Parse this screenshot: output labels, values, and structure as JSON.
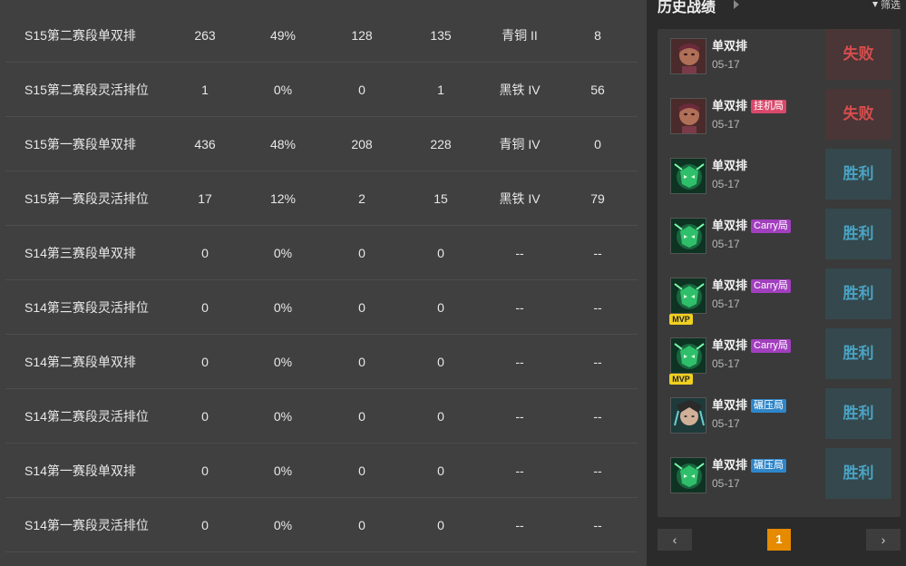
{
  "seasons": [
    {
      "name": "S15第二赛段单双排",
      "games": "263",
      "winrate": "49%",
      "wins": "128",
      "losses": "135",
      "tier": "青铜 II",
      "lp": "8"
    },
    {
      "name": "S15第二赛段灵活排位",
      "games": "1",
      "winrate": "0%",
      "wins": "0",
      "losses": "1",
      "tier": "黑铁 IV",
      "lp": "56"
    },
    {
      "name": "S15第一赛段单双排",
      "games": "436",
      "winrate": "48%",
      "wins": "208",
      "losses": "228",
      "tier": "青铜 IV",
      "lp": "0"
    },
    {
      "name": "S15第一赛段灵活排位",
      "games": "17",
      "winrate": "12%",
      "wins": "2",
      "losses": "15",
      "tier": "黑铁 IV",
      "lp": "79"
    },
    {
      "name": "S14第三赛段单双排",
      "games": "0",
      "winrate": "0%",
      "wins": "0",
      "losses": "0",
      "tier": "--",
      "lp": "--"
    },
    {
      "name": "S14第三赛段灵活排位",
      "games": "0",
      "winrate": "0%",
      "wins": "0",
      "losses": "0",
      "tier": "--",
      "lp": "--"
    },
    {
      "name": "S14第二赛段单双排",
      "games": "0",
      "winrate": "0%",
      "wins": "0",
      "losses": "0",
      "tier": "--",
      "lp": "--"
    },
    {
      "name": "S14第二赛段灵活排位",
      "games": "0",
      "winrate": "0%",
      "wins": "0",
      "losses": "0",
      "tier": "--",
      "lp": "--"
    },
    {
      "name": "S14第一赛段单双排",
      "games": "0",
      "winrate": "0%",
      "wins": "0",
      "losses": "0",
      "tier": "--",
      "lp": "--"
    },
    {
      "name": "S14第一赛段灵活排位",
      "games": "0",
      "winrate": "0%",
      "wins": "0",
      "losses": "0",
      "tier": "--",
      "lp": "--"
    }
  ],
  "history": {
    "title": "历史战绩",
    "filter_label": "筛选",
    "matches": [
      {
        "queue": "单双排",
        "tag": "",
        "tag_color": "",
        "date": "05-17",
        "result": "失败",
        "outcome": "loss",
        "champion_icon": "kaisa-icon",
        "mvp": ""
      },
      {
        "queue": "单双排",
        "tag": "挂机局",
        "tag_color": "#d9486b",
        "date": "05-17",
        "result": "失败",
        "outcome": "loss",
        "champion_icon": "kaisa-icon",
        "mvp": ""
      },
      {
        "queue": "单双排",
        "tag": "",
        "tag_color": "",
        "date": "05-17",
        "result": "胜利",
        "outcome": "win",
        "champion_icon": "thresh-icon",
        "mvp": ""
      },
      {
        "queue": "单双排",
        "tag": "Carry局",
        "tag_color": "#a23fbf",
        "date": "05-17",
        "result": "胜利",
        "outcome": "win",
        "champion_icon": "thresh-icon",
        "mvp": ""
      },
      {
        "queue": "单双排",
        "tag": "Carry局",
        "tag_color": "#a23fbf",
        "date": "05-17",
        "result": "胜利",
        "outcome": "win",
        "champion_icon": "thresh-icon",
        "mvp": "MVP"
      },
      {
        "queue": "单双排",
        "tag": "Carry局",
        "tag_color": "#a23fbf",
        "date": "05-17",
        "result": "胜利",
        "outcome": "win",
        "champion_icon": "thresh-icon",
        "mvp": "MVP"
      },
      {
        "queue": "单双排",
        "tag": "碾压局",
        "tag_color": "#2f86c9",
        "date": "05-17",
        "result": "胜利",
        "outcome": "win",
        "champion_icon": "elise-icon",
        "mvp": ""
      },
      {
        "queue": "单双排",
        "tag": "碾压局",
        "tag_color": "#2f86c9",
        "date": "05-17",
        "result": "胜利",
        "outcome": "win",
        "champion_icon": "thresh-icon",
        "mvp": ""
      }
    ]
  },
  "pager": {
    "prev": "‹",
    "page": "1",
    "next": "›"
  },
  "colors": {
    "accent": "#e68a00",
    "loss": "#d64d4d",
    "win": "#4aa3c4"
  }
}
